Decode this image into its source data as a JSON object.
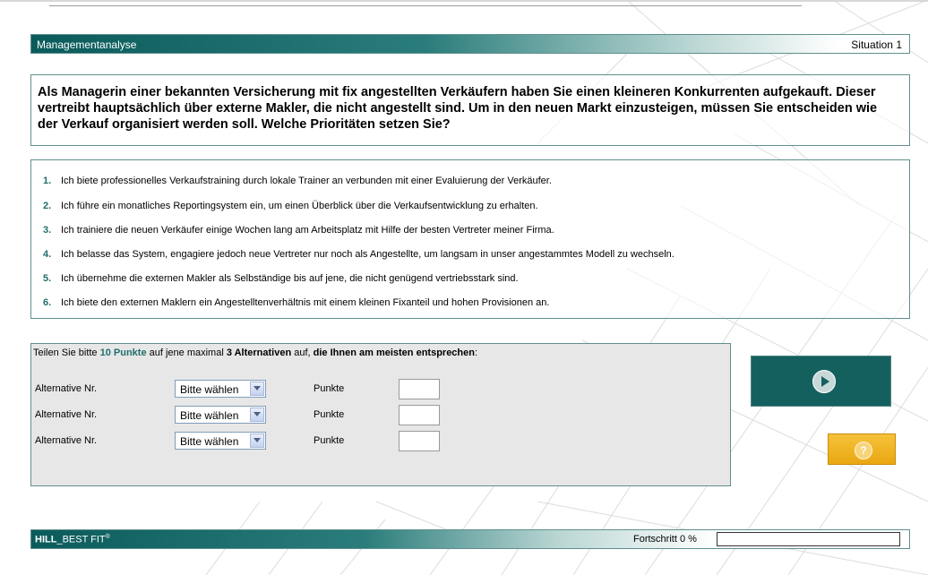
{
  "header": {
    "title": "Managementanalyse",
    "situation": "Situation 1"
  },
  "question": "Als Managerin einer bekannten Versicherung mit fix angestellten Verkäufern haben Sie einen kleineren Konkurrenten aufgekauft. Dieser vertreibt hauptsächlich über externe Makler, die nicht angestellt sind. Um in den neuen Markt einzusteigen, müssen Sie entscheiden wie der Verkauf organisiert werden soll. Welche Prioritäten setzen Sie?",
  "options": [
    {
      "num": "1.",
      "text": "Ich biete professionelles Verkaufstraining durch lokale Trainer an verbunden mit einer Evaluierung der Verkäufer."
    },
    {
      "num": "2.",
      "text": "Ich führe ein monatliches Reportingsystem ein, um einen Überblick über die Verkaufsentwicklung zu erhalten."
    },
    {
      "num": "3.",
      "text": "Ich trainiere die neuen Verkäufer einige Wochen lang am Arbeitsplatz mit Hilfe der besten Vertreter meiner Firma."
    },
    {
      "num": "4.",
      "text": "Ich belasse das System, engagiere jedoch neue Vertreter nur noch als Angestellte, um langsam in unser angestammtes Modell zu wechseln."
    },
    {
      "num": "5.",
      "text": "Ich übernehme die externen Makler als Selbständige bis auf jene, die nicht genügend vertriebsstark sind."
    },
    {
      "num": "6.",
      "text": "Ich biete den externen Maklern ein Angestelltenverhältnis mit einem kleinen Fixanteil und hohen Provisionen an."
    }
  ],
  "instruction": {
    "part1": "Teilen Sie bitte ",
    "points": "10 Punkte",
    "part2": " auf jene maximal ",
    "alternatives": "3 Alternativen",
    "part3": " auf, ",
    "emphasis": "die Ihnen am meisten entsprechen",
    "part4": ":"
  },
  "allocation": [
    {
      "label": "Alternative Nr.",
      "select": "Bitte wählen",
      "points_label": "Punkte",
      "points": ""
    },
    {
      "label": "Alternative Nr.",
      "select": "Bitte wählen",
      "points_label": "Punkte",
      "points": ""
    },
    {
      "label": "Alternative Nr.",
      "select": "Bitte wählen",
      "points_label": "Punkte",
      "points": ""
    }
  ],
  "buttons": {
    "next_icon": "play-icon",
    "help_icon": "question-icon",
    "help_symbol": "?"
  },
  "footer": {
    "brand_bold": "HILL",
    "brand_rest": "_BEST FIT",
    "brand_mark": "®",
    "progress_label": "Fortschritt 0 %",
    "progress_value": 0
  },
  "colors": {
    "teal_dark": "#0b5b5b",
    "teal_accent": "#1e6e6c",
    "help_yellow": "#f0b323",
    "panel_gray": "#e8e7e7"
  }
}
